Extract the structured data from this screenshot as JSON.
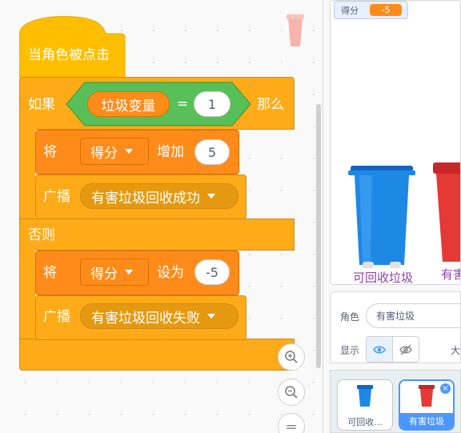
{
  "script": {
    "hat_label": "当角色被点击",
    "if_label": "如果",
    "variable_name": "垃圾变量",
    "equals_sign": "=",
    "compare_value": "1",
    "then_label": "那么",
    "change_block": {
      "verb": "将",
      "variable": "得分",
      "action": "增加",
      "value": "5"
    },
    "broadcast_success": {
      "verb": "广播",
      "message": "有害垃圾回收成功"
    },
    "else_label": "否则",
    "set_block": {
      "verb": "将",
      "variable": "得分",
      "action": "设为",
      "value": "-5"
    },
    "broadcast_fail": {
      "verb": "广播",
      "message": "有害垃圾回收失败"
    }
  },
  "zoom": {
    "zoom_in_icon": "zoom-in-icon",
    "zoom_out_icon": "zoom-out-icon",
    "reset_icon": "equals-icon",
    "reset_label": "="
  },
  "stage": {
    "monitor": {
      "label": "得分",
      "value": "-5"
    },
    "bins": [
      {
        "label": "可回收垃圾",
        "color": "#1e88e5"
      },
      {
        "label": "有害",
        "color": "#e53935"
      }
    ]
  },
  "sprite_info": {
    "sprite_label": "角色",
    "sprite_name": "有害垃圾",
    "show_label": "显示",
    "show_icon": "eye-icon",
    "hide_icon": "eye-slash-icon",
    "size_label": "大"
  },
  "sprite_list": [
    {
      "name": "可回收...",
      "selected": false
    },
    {
      "name": "有害垃圾",
      "selected": true,
      "delete_label": "×"
    }
  ],
  "colors": {
    "events": "#ffab19",
    "variables": "#ff8c1a",
    "operators": "#59c059",
    "selected": "#4c97ff"
  }
}
